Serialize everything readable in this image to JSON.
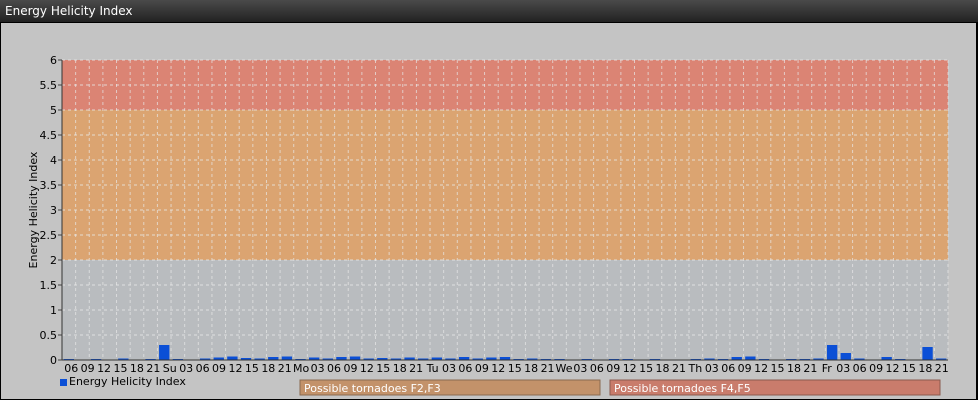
{
  "window": {
    "title": "Energy Helicity Index"
  },
  "chart_data": {
    "type": "bar",
    "title": "",
    "ylabel": "Energy Helicity Index",
    "ylim": [
      0,
      6
    ],
    "yticks": [
      "0",
      "0.5",
      "1",
      "1.5",
      "2",
      "2.5",
      "3",
      "3.5",
      "4",
      "4.5",
      "5",
      "5.5",
      "6"
    ],
    "xtick_labels": [
      "06",
      "09",
      "12",
      "15",
      "18",
      "21",
      "Su",
      "03",
      "06",
      "09",
      "12",
      "15",
      "18",
      "21",
      "Mo",
      "03",
      "06",
      "09",
      "12",
      "15",
      "18",
      "21",
      "Tu",
      "03",
      "06",
      "09",
      "12",
      "15",
      "18",
      "21",
      "We",
      "03",
      "06",
      "09",
      "12",
      "15",
      "18",
      "21",
      "Th",
      "03",
      "06",
      "09",
      "12",
      "15",
      "18",
      "21",
      "Fr",
      "03",
      "06",
      "09",
      "12",
      "15",
      "18",
      "21"
    ],
    "bands": [
      {
        "from": 2,
        "to": 5,
        "label": "Possible tornadoes F2,F3",
        "color": "#e0a063"
      },
      {
        "from": 5,
        "to": 6,
        "label": "Possible tornadoes F4,F5",
        "color": "#e07a66"
      }
    ],
    "series": [
      {
        "name": "Energy Helicity Index",
        "color": "#0b4fd6",
        "values": [
          0.02,
          0.01,
          0.02,
          0.01,
          0.03,
          0.01,
          0.02,
          0.3,
          0.02,
          0.01,
          0.03,
          0.05,
          0.07,
          0.04,
          0.03,
          0.06,
          0.07,
          0.02,
          0.05,
          0.03,
          0.06,
          0.07,
          0.03,
          0.04,
          0.03,
          0.05,
          0.03,
          0.05,
          0.03,
          0.06,
          0.03,
          0.05,
          0.06,
          0.02,
          0.03,
          0.02,
          0.02,
          0.01,
          0.02,
          0.01,
          0.02,
          0.02,
          0.01,
          0.02,
          0.01,
          0.01,
          0.02,
          0.03,
          0.02,
          0.06,
          0.07,
          0.02,
          0.01,
          0.02,
          0.02,
          0.03,
          0.3,
          0.14,
          0.03,
          0.01,
          0.06,
          0.02,
          0.01,
          0.26,
          0.03
        ]
      }
    ],
    "legend": {
      "label": "Energy Helicity Index",
      "position": "bottom-left"
    }
  }
}
